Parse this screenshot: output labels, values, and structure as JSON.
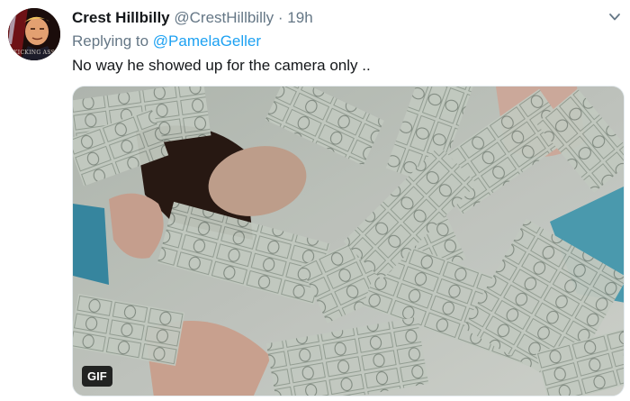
{
  "tweet": {
    "display_name": "Crest Hillbilly",
    "handle": "@CrestHillbilly",
    "separator": "·",
    "time": "19h",
    "reply_label": "Replying to",
    "reply_handle": "@PamelaGeller",
    "text": "No way he showed up for the camera only ..",
    "avatar_caption": "KICKING ASS",
    "media_badge": "GIF"
  },
  "icons": {
    "menu": "chevron-down-icon"
  },
  "colors": {
    "name": "#14171a",
    "secondary": "#657786",
    "link": "#1da1f2"
  }
}
